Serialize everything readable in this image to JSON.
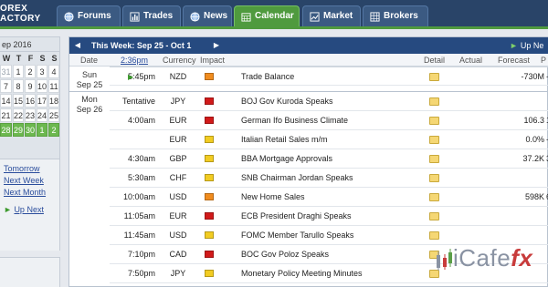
{
  "brand": {
    "line1": "OREX",
    "line2": "ACTORY"
  },
  "nav": {
    "tabs": [
      {
        "label": "Forums",
        "icon": "globe-icon"
      },
      {
        "label": "Trades",
        "icon": "chart-bars-icon"
      },
      {
        "label": "News",
        "icon": "globe-icon"
      },
      {
        "label": "Calendar",
        "icon": "calendar-icon",
        "active": true
      },
      {
        "label": "Market",
        "icon": "line-chart-icon"
      },
      {
        "label": "Brokers",
        "icon": "grid-icon"
      }
    ]
  },
  "mini_calendar": {
    "month": "ep 2016",
    "dow": [
      "W",
      "T",
      "F",
      "S",
      "S"
    ],
    "weeks": [
      [
        "31",
        "1",
        "2",
        "3",
        "4"
      ],
      [
        "7",
        "8",
        "9",
        "10",
        "11"
      ],
      [
        "14",
        "15",
        "16",
        "17",
        "18"
      ],
      [
        "21",
        "22",
        "23",
        "24",
        "25"
      ],
      [
        "28",
        "29",
        "30",
        "1",
        "2"
      ]
    ]
  },
  "side_links": {
    "tomorrow": "Tomorrow",
    "next_week": "Next Week",
    "next_month": "Next Month",
    "up_next": "Up Next"
  },
  "week_bar": {
    "label": "This Week: Sep 25 - Oct 1",
    "up_next": "Up Ne"
  },
  "columns": {
    "date": "Date",
    "time": "2:36pm",
    "currency": "Currency",
    "impact": "Impact",
    "detail": "Detail",
    "actual": "Actual",
    "forecast": "Forecast",
    "previous": "P"
  },
  "days": [
    {
      "label": "Sun",
      "date": "Sep 25"
    },
    {
      "label": "Mon",
      "date": "Sep 26"
    }
  ],
  "colors": {
    "high": "#d11a1a",
    "medium": "#f08c1f",
    "low": "#f2cc22",
    "accent": "#4f9a3e",
    "navy": "#264a80"
  },
  "events": [
    {
      "time": "5:45pm",
      "cur": "NZD",
      "impact": "medium",
      "event": "Trade Balance",
      "forecast": "-730M",
      "previous": "-",
      "upcoming": true
    },
    {
      "time": "Tentative",
      "cur": "JPY",
      "impact": "high",
      "event": "BOJ Gov Kuroda Speaks",
      "forecast": "",
      "previous": ""
    },
    {
      "time": "4:00am",
      "cur": "EUR",
      "impact": "high",
      "event": "German Ifo Business Climate",
      "forecast": "106.3",
      "previous": "1"
    },
    {
      "time": "",
      "cur": "EUR",
      "impact": "low",
      "event": "Italian Retail Sales m/m",
      "forecast": "0.0%",
      "previous": "-"
    },
    {
      "time": "4:30am",
      "cur": "GBP",
      "impact": "low",
      "event": "BBA Mortgage Approvals",
      "forecast": "37.2K",
      "previous": "3"
    },
    {
      "time": "5:30am",
      "cur": "CHF",
      "impact": "low",
      "event": "SNB Chairman Jordan Speaks",
      "forecast": "",
      "previous": ""
    },
    {
      "time": "10:00am",
      "cur": "USD",
      "impact": "medium",
      "event": "New Home Sales",
      "forecast": "598K",
      "previous": "6"
    },
    {
      "time": "11:05am",
      "cur": "EUR",
      "impact": "high",
      "event": "ECB President Draghi Speaks",
      "forecast": "",
      "previous": ""
    },
    {
      "time": "11:45am",
      "cur": "USD",
      "impact": "low",
      "event": "FOMC Member Tarullo Speaks",
      "forecast": "",
      "previous": ""
    },
    {
      "time": "7:10pm",
      "cur": "CAD",
      "impact": "high",
      "event": "BOC Gov Poloz Speaks",
      "forecast": "",
      "previous": ""
    },
    {
      "time": "7:50pm",
      "cur": "JPY",
      "impact": "low",
      "event": "Monetary Policy Meeting Minutes",
      "forecast": "",
      "previous": ""
    }
  ],
  "watermark": {
    "text": "iCafe",
    "fx": "fx"
  }
}
